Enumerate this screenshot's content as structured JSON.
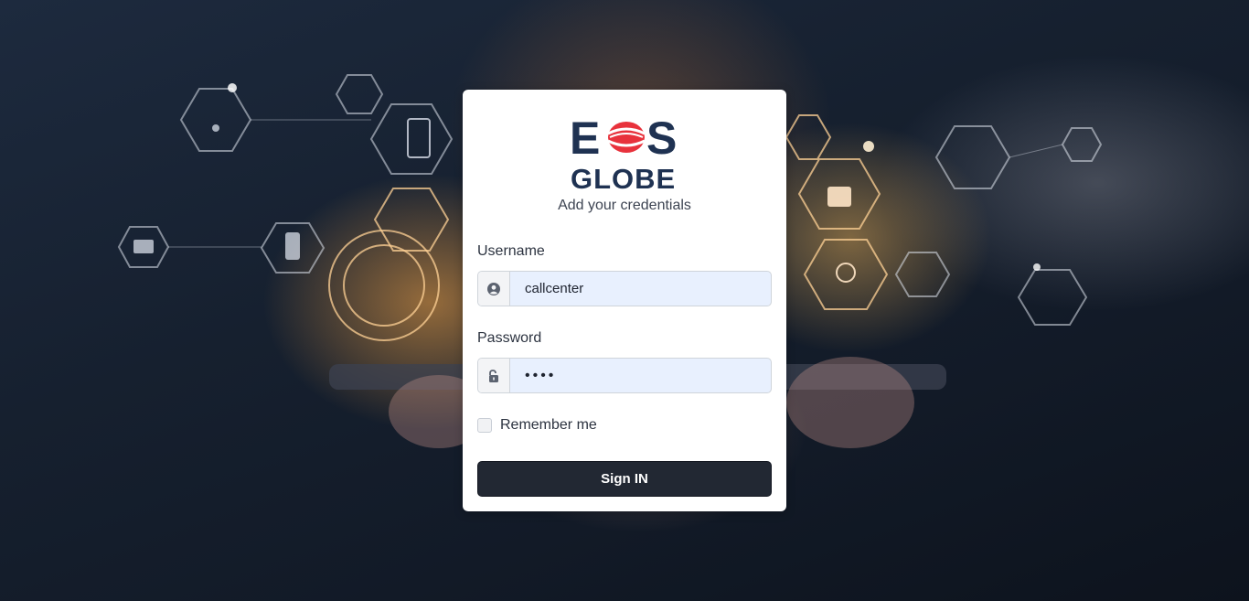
{
  "brand": {
    "line1": "EOS",
    "line2": "GLOBE",
    "colors": {
      "navy": "#1f3252",
      "red": "#e8323c"
    }
  },
  "subtitle": "Add your credentials",
  "username": {
    "label": "Username",
    "value": "callcenter",
    "icon": "user-circle-icon"
  },
  "password": {
    "label": "Password",
    "value": "••••",
    "icon": "unlock-icon"
  },
  "remember": {
    "label": "Remember me",
    "checked": false
  },
  "signin_label": "Sign IN",
  "colors": {
    "button": "#222833",
    "autofill": "#e8f0fe"
  }
}
